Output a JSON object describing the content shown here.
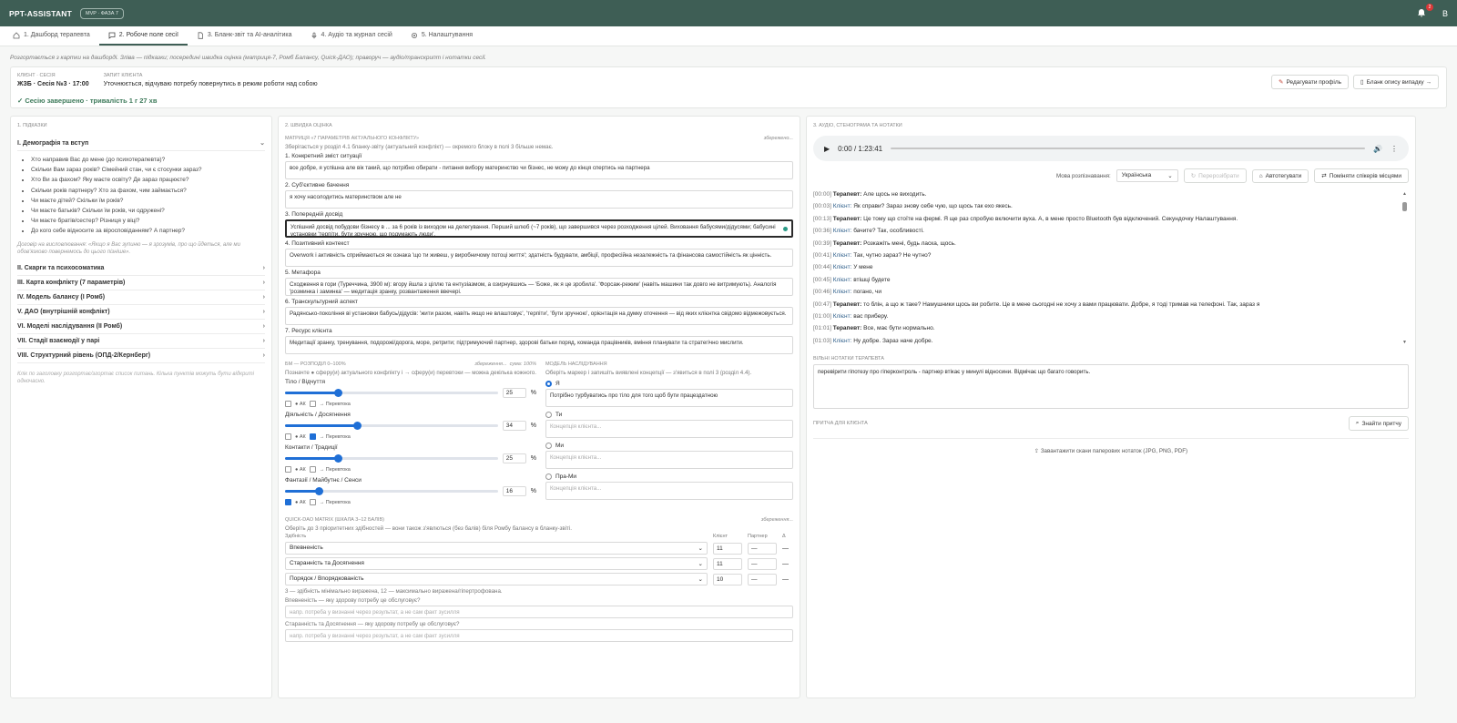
{
  "app": {
    "title": "PPT-ASSISTANT",
    "badge": "MVP · ФАЗА 7",
    "notifications": "2",
    "avatar": "B"
  },
  "tabs": [
    {
      "label": "1. Дашборд терапевта",
      "icon": "home-icon"
    },
    {
      "label": "2. Робоче поле сесії",
      "icon": "chat-icon"
    },
    {
      "label": "3. Бланк-звіт та AI-аналітика",
      "icon": "document-icon"
    },
    {
      "label": "4. Аудіо та журнал сесій",
      "icon": "microphone-icon"
    },
    {
      "label": "5. Налаштування",
      "icon": "gear-icon"
    }
  ],
  "hint": "Розгортається з картки на дашборді. Зліва — підказки; посередині швидка оцінка (матриця-7, Ромб Балансу, Quick-ДАО); праворуч — аудіо/транскрипт і нотатки сесії.",
  "client": {
    "session_label": "КЛІЄНТ · СЕСІЯ",
    "session_value": "ЖЗБ · Сесія №3 · 17:00",
    "request_label": "ЗАПИТ КЛІЄНТА",
    "request_value": "Уточнюється, відчуваю потребу повернутись в режим роботи над собою",
    "status": "✓ Сесію завершено · тривалість 1 г 27 хв",
    "edit_button": "Редагувати профіль",
    "case_button": "Бланк опису випадку →"
  },
  "hints_panel": {
    "title": "1. ПІДКАЗКИ",
    "first_section": "I. Демографія та вступ",
    "questions": [
      "Хто направив Вас до мене (до психотерапевта)?",
      "Скільки Вам зараз років? Сімейний стан, чи є стосунки зараз?",
      "Хто Ви за фахом? Яку маєте освіту? Де зараз працюєте?",
      "Скільки років партнеру? Хто за фахом, чим займається?",
      "Чи маєте дітей? Скільки їм років?",
      "Чи маєте батьків? Скільки їм років, чи одружені?",
      "Чи маєте братів/сестер? Різниця у віці?",
      "До кого себе відносите за віросповіданням? А партнер?"
    ],
    "agreement": "Договір на висловлювання: «Якщо я Вас зупиню — я зрозумів, про що йдеться, але ми обов'язково повернемось до цього пізніше».",
    "sections": [
      "II. Скарги та психосоматика",
      "III. Карта конфлікту (7 параметрів)",
      "IV. Модель балансу (І Ромб)",
      "V. ДАО (внутрішній конфлікт)",
      "VI. Моделі наслідування (ІІ Ромб)",
      "VII. Стадії взаємодії у парі",
      "VIII. Структурний рівень (ОПД-2/Кернберг)"
    ],
    "footer": "Клік по заголовку розгортає/згортає список питань. Кілька пунктів можуть бути відкриті одночасно."
  },
  "assessment": {
    "title": "2. ШВИДКА ОЦІНКА",
    "matrix_title": "МАТРИЦЯ «7 ПАРАМЕТРІВ АКТУАЛЬНОГО КОНФЛІКТУ»",
    "saved": "збережено...",
    "matrix_note": "Зберігається у розділ 4.1 бланку-звіту (актуальний конфлікт) — окремого блоку в полі 3 більше немає.",
    "fields": [
      {
        "label": "1. Конкретний зміст ситуації",
        "value": "все добре, я успішна але вік такий, що потрібно обирати - питання вибору материнство чи бізнес, не можу до кінця спертись на партнера"
      },
      {
        "label": "2. Суб'єктивне бачення",
        "value": "я хочу насолодитись материнством але не"
      },
      {
        "label": "3. Попередній досвід",
        "value": "Успішний досвід побудови бізнесу в ... за 6 років із виходом на делегування. Перший шлюб (~7 років), що завершився через розходження цілей. Виховання бабусями/дідусями; бабусині установки 'терпіти, бути зручною, що подумають люди'."
      },
      {
        "label": "4. Позитивний контекст",
        "value": "Overwork і активність сприймаються як ознака 'що ти живеш, у виробничому потоці життя'; здатність будувати, амбіції, професійна незалежність та фінансова самостійність як цінність."
      },
      {
        "label": "5. Метафора",
        "value": "Сходження в гори (Туреччина, 3900 м): вгору йшла з ціллю та ентузіазмом, а озирнувшись — 'Боже, як я це зробила'. 'Форсаж-режим' (навіть машини так довго не витримують). Аналогія 'розминка і заминка' — медитація зранку, розвантаження ввечері."
      },
      {
        "label": "6. Транскультурний аспект",
        "value": "Радянсько-покоління ві установки бабусь/дідусів: 'жити разом, навіть якщо не влаштовує', 'терпіти', 'бути зручною', орієнтація на думку оточення — від яких клієнтка свідомо відмежовується."
      },
      {
        "label": "7. Ресурс клієнта",
        "value": "Медитації зранку, тренування, подорожі/дорога, море, ретрити; підтримуючий партнер, здорові батьки поряд, команда працівників, вміння планувати та стратегічно мислити."
      }
    ],
    "bm_title": "БМ — РОЗПОДІЛ 0–100%",
    "bm_saved": "збереження...",
    "bm_sum": "сума: 100%",
    "bm_note": "Позначте ● сферу(и) актуального конфлікту і → сферу(и) перевтоки — можна декілька кожного.",
    "sliders": [
      {
        "label": "Тіло / Відчуття",
        "value": "25",
        "pct": 25,
        "ak": false,
        "flow": false
      },
      {
        "label": "Діяльність / Досягнення",
        "value": "34",
        "pct": 34,
        "ak": false,
        "flow": true
      },
      {
        "label": "Контакти / Традиції",
        "value": "25",
        "pct": 25,
        "ak": false,
        "flow": false
      },
      {
        "label": "Фантазії / Майбутнє / Сенси",
        "value": "16",
        "pct": 16,
        "ak": true,
        "flow": false
      }
    ],
    "ak_label": "● АК",
    "flow_label": "→ Перевтока",
    "percent": "%",
    "model_title": "МОДЕЛЬ НАСЛІДУВАННЯ",
    "model_note": "Оберіть маркер і запишіть виявлені концепції — з'явиться в полі 3 (розділ 4.4).",
    "models": [
      {
        "label": "Я",
        "value": "Потрібно турбуватись про тіло для того щоб бути працездатною",
        "selected": true
      },
      {
        "label": "Ти",
        "value": "",
        "selected": false
      },
      {
        "label": "Ми",
        "value": "",
        "selected": false
      },
      {
        "label": "Пра-Ми",
        "value": "",
        "selected": false
      }
    ],
    "concept_placeholder": "Концепція клієнта...",
    "qdao_title": "QUICK-DAO MATRIX (ШКАЛА 3–12 БАЛІВ)",
    "qdao_saved": "збереження...",
    "qdao_note": "Оберіть до 3 пріоритетних здібностей — вони також з'явлються (без балів) біля Ромбу балансу в бланку-звіті.",
    "qdao_headers": {
      "ability": "Здібність",
      "client": "Клієнт",
      "partner": "Партнер",
      "delta": "Δ"
    },
    "qdao_rows": [
      {
        "ability": "Впевненість",
        "client": "11",
        "partner": "—",
        "delta": "—"
      },
      {
        "ability": "Старанність та Досягнення",
        "client": "11",
        "partner": "—",
        "delta": "—"
      },
      {
        "ability": "Порядок / Впорядкованість",
        "client": "10",
        "partner": "—",
        "delta": "—"
      }
    ],
    "qdao_scale": "3 — здібність мінімально виражена, 12 — максимально виражена/гіпертрофована.",
    "need_q1": "Впевненість — яку здорову потребу це обслуговує?",
    "need_q2": "Старанність та Досягнення — яку здорову потребу це обслуговує?",
    "need_placeholder": "напр. потреба у визнанні через результат, а не сам факт зусилля"
  },
  "audio": {
    "title": "3. АУДІО, СТЕНОГРАМА ТА НОТАТКИ",
    "time": "0:00 / 1:23:41",
    "lang_label": "Мова розпізнавання:",
    "lang_value": "Українська",
    "recognize": "Перерозібрати",
    "autotag": "Автотегувати",
    "swap": "Поміняти спікерів місцями",
    "transcript": [
      {
        "t": "[00:00]",
        "s": "Терапевт:",
        "r": "therapist",
        "x": "Але щось не виходить."
      },
      {
        "t": "[00:03]",
        "s": "Клієнт:",
        "r": "client",
        "x": "Як справи? Зараз знову себе чую, що щось так ехо якесь."
      },
      {
        "t": "[00:13]",
        "s": "Терапевт:",
        "r": "therapist",
        "x": "Це тому що стоїте на фермі. Я ще раз спробую включити вуха. А, в мене просто Bluetooth був відключений. Секундочку Налаштування."
      },
      {
        "t": "[00:36]",
        "s": "Клієнт:",
        "r": "client",
        "x": "бачите? Так, особливості."
      },
      {
        "t": "[00:39]",
        "s": "Терапевт:",
        "r": "therapist",
        "x": "Розкажіть мені, будь ласка, щось."
      },
      {
        "t": "[00:41]",
        "s": "Клієнт:",
        "r": "client",
        "x": "Так, чутно зараз? Не чутно?"
      },
      {
        "t": "[00:44]",
        "s": "Клієнт:",
        "r": "client",
        "x": "У мене"
      },
      {
        "t": "[00:45]",
        "s": "Клієнт:",
        "r": "client",
        "x": "втішці будете"
      },
      {
        "t": "[00:46]",
        "s": "Клієнт:",
        "r": "client",
        "x": "погано, чи"
      },
      {
        "t": "[00:47]",
        "s": "Терапевт:",
        "r": "therapist",
        "x": "то блін, а що ж таке? Намушники щось ви робите. Це в мене сьогодні не хочу з вами працювати. Добре, я тоді тримав на телефоні. Так, зараз я"
      },
      {
        "t": "[01:00]",
        "s": "Клієнт:",
        "r": "client",
        "x": "вас приберу."
      },
      {
        "t": "[01:01]",
        "s": "Терапевт:",
        "r": "therapist",
        "x": "Все, має бути нормально."
      },
      {
        "t": "[01:03]",
        "s": "Клієнт:",
        "r": "client",
        "x": "Ну добре. Зараз наче добре."
      },
      {
        "t": "[01:05]",
        "s": "Терапевт:",
        "r": "therapist",
        "x": "Ну, я чую тепер себе не чую."
      }
    ],
    "notes_title": "ВІЛЬНІ НОТАТКИ ТЕРАПЕВТА",
    "notes_value": "перевірити гіпотезу про гіперконтроль - партнер втікає у минулі відносини. Відмічає що багато говорить.",
    "parable_title": "ПРИТЧА ДЛЯ КЛІЄНТА",
    "parable_button": "Знайти притчу",
    "upload": "Завантажити скани паперових нотаток (JPG, PNG, PDF)"
  },
  "colors": {
    "header": "#3e5e55",
    "accent": "#1f6fd6",
    "success": "#3d7a5a"
  }
}
